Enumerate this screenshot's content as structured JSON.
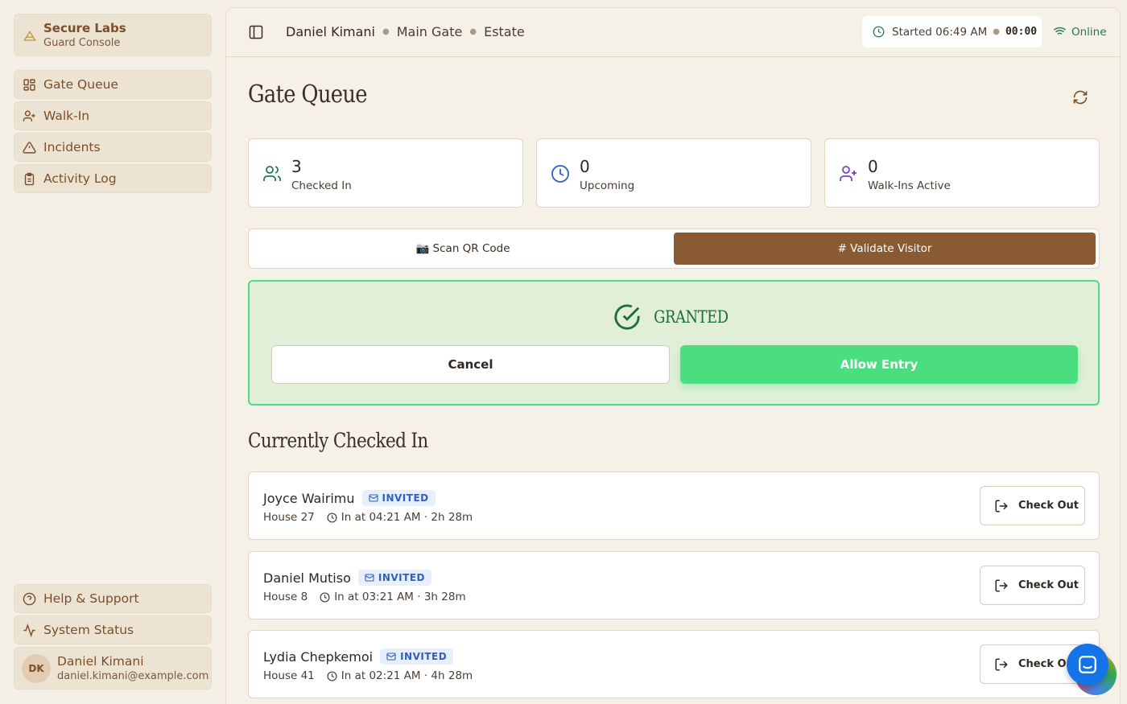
{
  "brand": {
    "name": "Secure Labs",
    "subtitle": "Guard Console"
  },
  "nav": [
    {
      "label": "Gate Queue",
      "icon": "grid-icon"
    },
    {
      "label": "Walk-In",
      "icon": "user-plus-icon"
    },
    {
      "label": "Incidents",
      "icon": "alert-triangle-icon"
    },
    {
      "label": "Activity Log",
      "icon": "clipboard-icon"
    }
  ],
  "bottom_nav": [
    {
      "label": "Help & Support",
      "icon": "help-circle-icon"
    },
    {
      "label": "System Status",
      "icon": "activity-icon"
    }
  ],
  "user": {
    "initials": "DK",
    "name": "Daniel Kimani",
    "email": "daniel.kimani@example.com"
  },
  "topbar": {
    "guard": "Daniel Kimani",
    "gate": "Main Gate",
    "site": "Estate",
    "started": "Started 06:49 AM",
    "timer": "00:00",
    "status": "Online"
  },
  "page": {
    "title": "Gate Queue"
  },
  "stats": [
    {
      "value": "3",
      "label": "Checked In",
      "color": "#1f7a4c"
    },
    {
      "value": "0",
      "label": "Upcoming",
      "color": "#2f5fc2"
    },
    {
      "value": "0",
      "label": "Walk-Ins Active",
      "color": "#7b3fc4"
    }
  ],
  "mode_toggle": {
    "scan": "📷 Scan QR Code",
    "validate": "# Validate Visitor",
    "active": "validate"
  },
  "result": {
    "status": "GRANTED",
    "cancel": "Cancel",
    "allow": "Allow Entry"
  },
  "checked_in": {
    "title": "Currently Checked In",
    "rows": [
      {
        "name": "Joyce Wairimu",
        "badge": "INVITED",
        "house": "House 27",
        "time": "In at 04:21 AM · 2h 28m",
        "action": "Check Out"
      },
      {
        "name": "Daniel Mutiso",
        "badge": "INVITED",
        "house": "House 8",
        "time": "In at 03:21 AM · 3h 28m",
        "action": "Check Out"
      },
      {
        "name": "Lydia Chepkemoi",
        "badge": "INVITED",
        "house": "House 41",
        "time": "In at 02:21 AM · 4h 28m",
        "action": "Check Out"
      }
    ]
  },
  "colors": {
    "accent": "#8a5a32",
    "granted": "#4ade80",
    "background": "#f5f0e6"
  }
}
